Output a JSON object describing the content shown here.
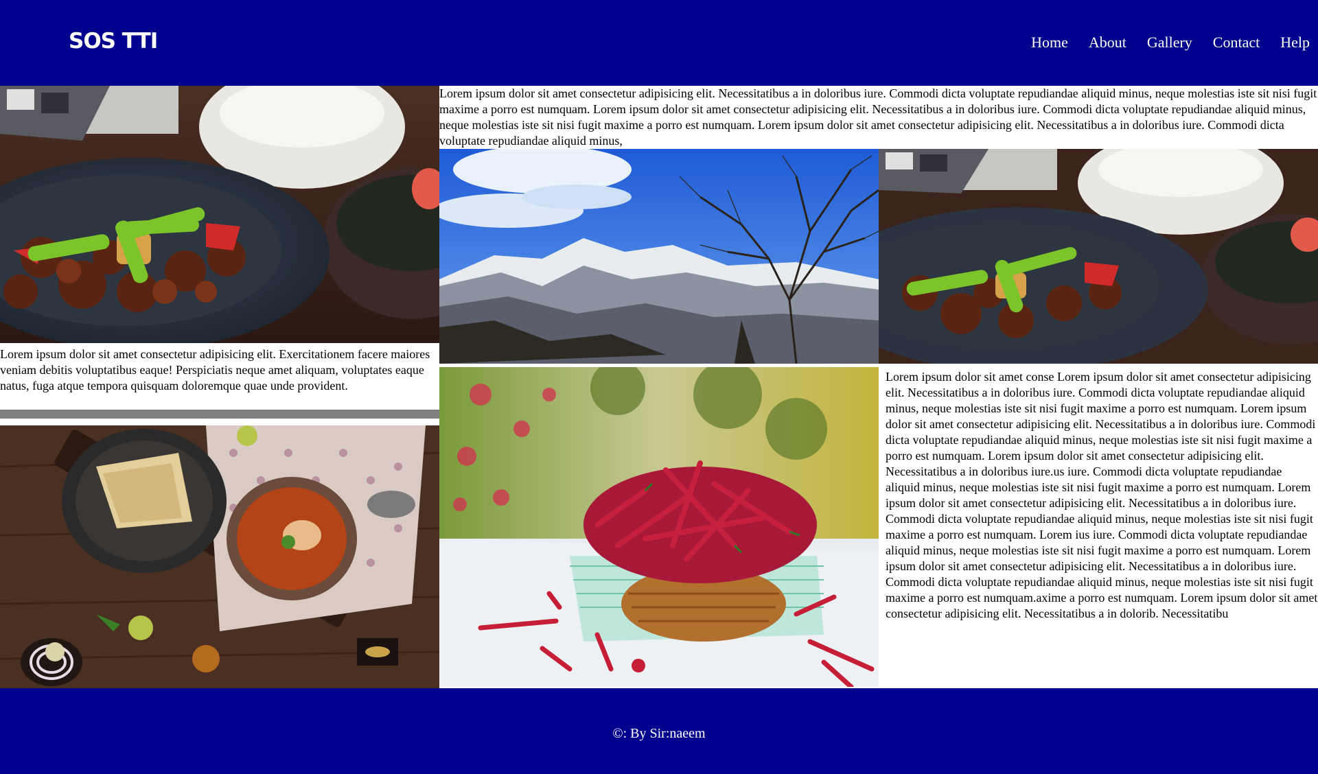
{
  "header": {
    "logo": "SOS TTI",
    "nav": [
      "Home",
      "About",
      "Gallery",
      "Contact",
      "Help"
    ]
  },
  "content": {
    "top_text": "Lorem ipsum dolor sit amet consectetur adipisicing elit. Necessitatibus a in doloribus iure. Commodi dicta voluptate repudiandae aliquid minus, neque molestias iste sit nisi fugit maxime a porro est numquam. Lorem ipsum dolor sit amet consectetur adipisicing elit. Necessitatibus a in doloribus iure. Commodi dicta voluptate repudiandae aliquid minus, neque molestias iste sit nisi fugit maxime a porro est numquam. Lorem ipsum dolor sit amet consectetur adipisicing elit. Necessitatibus a in doloribus iure. Commodi dicta voluptate repudiandae aliquid minus,",
    "left_text": "Lorem ipsum dolor sit amet consectetur adipisicing elit. Exercitationem facere maiores veniam debitis voluptatibus eaque! Perspiciatis neque amet aliquam, voluptates eaque natus, fuga atque tempora quisquam doloremque quae unde provident.",
    "right_text": "Lorem ipsum dolor sit amet conse Lorem ipsum dolor sit amet consectetur adipisicing elit. Necessitatibus a in doloribus iure. Commodi dicta voluptate repudiandae aliquid minus, neque molestias iste sit nisi fugit maxime a porro est numquam. Lorem ipsum dolor sit amet consectetur adipisicing elit. Necessitatibus a in doloribus iure. Commodi dicta voluptate repudiandae aliquid minus, neque molestias iste sit nisi fugit maxime a porro est numquam. Lorem ipsum dolor sit amet consectetur adipisicing elit. Necessitatibus a in doloribus iure.us iure. Commodi dicta voluptate repudiandae aliquid minus, neque molestias iste sit nisi fugit maxime a porro est numquam. Lorem ipsum dolor sit amet consectetur adipisicing elit. Necessitatibus a in doloribus iure. Commodi dicta voluptate repudiandae aliquid minus, neque molestias iste sit nisi fugit maxime a porro est numquam. Lorem ius iure. Commodi dicta voluptate repudiandae aliquid minus, neque molestias iste sit nisi fugit maxime a porro est numquam. Lorem ipsum dolor sit amet consectetur adipisicing elit. Necessitatibus a in doloribus iure. Commodi dicta voluptate repudiandae aliquid minus, neque molestias iste sit nisi fugit maxime a porro est numquam.axime a porro est numquam. Lorem ipsum dolor sit amet consectetur adipisicing elit. Necessitatibus a in dolorib. Necessitatibu"
  },
  "footer": {
    "text": "©: By Sir:naeem"
  },
  "colors": {
    "header_bg": "#00008e",
    "footer_bg": "#00008e",
    "divider": "#808080"
  }
}
